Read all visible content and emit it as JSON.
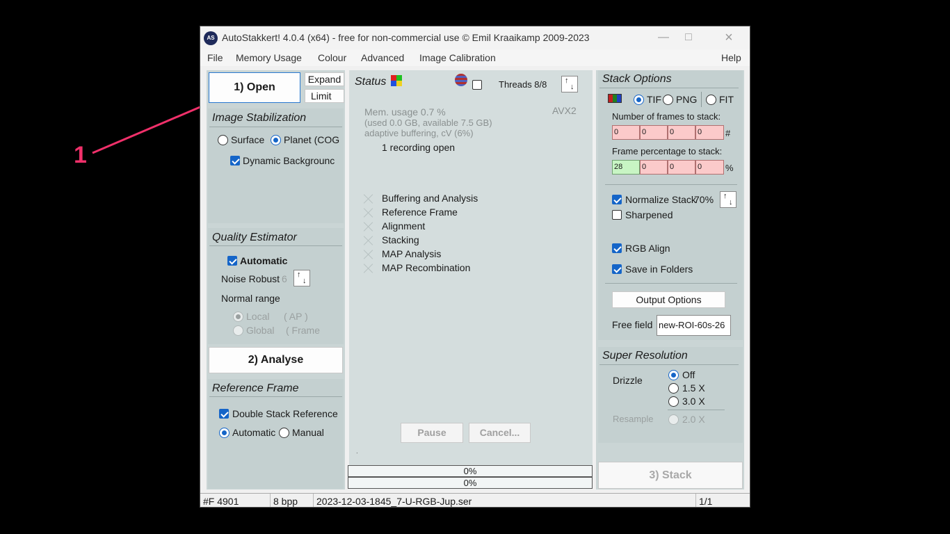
{
  "annotation": {
    "number": "1",
    "color": "#f0306a"
  },
  "window": {
    "title": "AutoStakkert! 4.0.4 (x64) - free for non-commercial use © Emil Kraaikamp 2009-2023",
    "icon_label": "AS"
  },
  "menu": [
    "File",
    "Memory Usage",
    "Colour",
    "Advanced",
    "Image Calibration",
    "Help"
  ],
  "left": {
    "open_label": "1) Open",
    "expand_label": "Expand",
    "limit_label": "Limit",
    "stabilization": {
      "title": "Image Stabilization",
      "surface": "Surface",
      "planet": "Planet (COG",
      "dynamic_bg": "Dynamic Backgrounc"
    },
    "quality": {
      "title": "Quality Estimator",
      "automatic": "Automatic",
      "noise_robust": "Noise Robust",
      "noise_value": "6",
      "normal_range": "Normal range",
      "local": "Local",
      "local_note": "( AP )",
      "global": "Global",
      "global_note": "( Frame"
    },
    "analyse_label": "2) Analyse",
    "reference": {
      "title": "Reference Frame",
      "double_stack": "Double Stack Reference",
      "automatic": "Automatic",
      "manual": "Manual"
    }
  },
  "status": {
    "title": "Status",
    "threads": "Threads 8/8",
    "avx": "AVX2",
    "mem_usage": "Mem. usage 0.7 %",
    "mem_detail": "(used 0.0 GB, available 7.5 GB)",
    "buffering": "adaptive buffering, cV (6%)",
    "recording": "1 recording open",
    "steps": [
      "Buffering and Analysis",
      "Reference Frame",
      "Alignment",
      "Stacking",
      "MAP Analysis",
      "MAP Recombination"
    ],
    "pause_label": "Pause",
    "cancel_label": "Cancel...",
    "progress1": "0%",
    "progress2": "0%",
    "dot": "."
  },
  "stack_options": {
    "title": "Stack Options",
    "tif": "TIF",
    "png": "PNG",
    "fit": "FIT",
    "frames_label": "Number of frames to stack:",
    "frames": [
      "0",
      "0",
      "0",
      "0"
    ],
    "frames_unit": "#",
    "percent_label": "Frame percentage to stack:",
    "percents": [
      "28",
      "0",
      "0",
      "0"
    ],
    "percent_unit": "%",
    "normalize": "Normalize Stack",
    "normalize_value": "70%",
    "sharpened": "Sharpened",
    "rgb_align": "RGB Align",
    "save_folders": "Save in Folders",
    "output_options": "Output Options",
    "free_field_label": "Free field",
    "free_field_value": "new-ROI-60s-26"
  },
  "super_resolution": {
    "title": "Super Resolution",
    "drizzle": "Drizzle",
    "off": "Off",
    "x15": "1.5 X",
    "x30": "3.0 X",
    "resample": "Resample",
    "x20": "2.0 X"
  },
  "stack_label": "3) Stack",
  "statusbar": {
    "frames": "#F 4901",
    "bpp": "8 bpp",
    "file": "2023-12-03-1845_7-U-RGB-Jup.ser",
    "page": "1/1"
  }
}
